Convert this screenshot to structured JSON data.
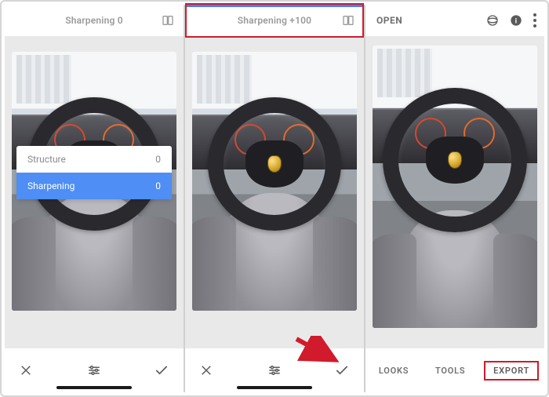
{
  "panel1": {
    "header": {
      "title": "Sharpening 0"
    },
    "adjust": {
      "rows": [
        {
          "label": "Structure",
          "value": "0"
        },
        {
          "label": "Sharpening",
          "value": "0"
        }
      ]
    }
  },
  "panel2": {
    "header": {
      "title": "Sharpening +100"
    }
  },
  "panel3": {
    "header": {
      "open": "OPEN"
    },
    "tabs": {
      "looks": "LOOKS",
      "tools": "TOOLS",
      "export": "EXPORT"
    }
  }
}
